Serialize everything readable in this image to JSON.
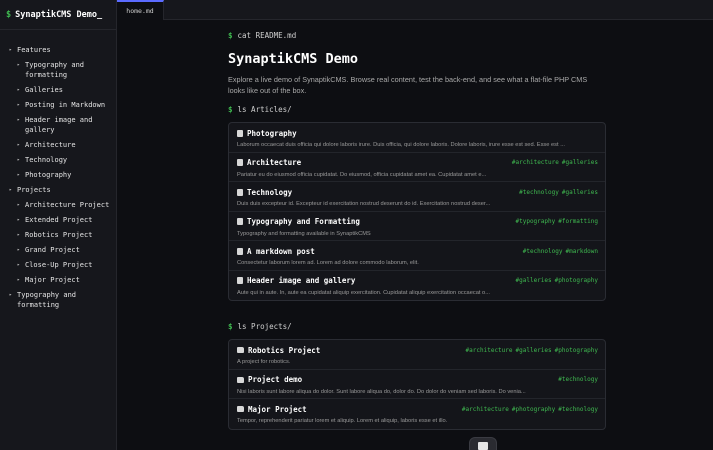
{
  "site": {
    "title": "SynaptikCMS Demo_"
  },
  "tab": {
    "label": "home.md"
  },
  "sidebar": {
    "items": [
      {
        "label": "Features",
        "level": 1
      },
      {
        "label": "Typography and formatting",
        "level": 2
      },
      {
        "label": "Galleries",
        "level": 2
      },
      {
        "label": "Posting in Markdown",
        "level": 2
      },
      {
        "label": "Header image and gallery",
        "level": 2
      },
      {
        "label": "Architecture",
        "level": 2
      },
      {
        "label": "Technology",
        "level": 2
      },
      {
        "label": "Photography",
        "level": 2
      },
      {
        "label": "Projects",
        "level": 1
      },
      {
        "label": "Architecture Project",
        "level": 2
      },
      {
        "label": "Extended Project",
        "level": 2
      },
      {
        "label": "Robotics Project",
        "level": 2
      },
      {
        "label": "Grand Project",
        "level": 2
      },
      {
        "label": "Close-Up Project",
        "level": 2
      },
      {
        "label": "Major Project",
        "level": 2
      },
      {
        "label": "Typography and formatting",
        "level": 1
      }
    ]
  },
  "main": {
    "cmd_readme": "cat README.md",
    "title": "SynaptikCMS Demo",
    "intro": "Explore a live demo of SynaptikCMS. Browse real content, test the back-end, and see what a flat-file PHP CMS looks like out of the box.",
    "cmd_articles": "ls Articles/",
    "cmd_projects": "ls Projects/",
    "articles": [
      {
        "title": "Photography",
        "desc": "Laborum occaecat duis officia qui dolore laboris irure. Duis officia, qui dolore laboris. Dolore laboris, irure esse est sed. Esse est ...",
        "tags": []
      },
      {
        "title": "Architecture",
        "desc": "Pariatur eu do eiusmod officia cupidatat. Do eiusmod, officia cupidatat amet ea. Cupidatat amet e...",
        "tags": [
          "#architecture",
          "#galleries"
        ]
      },
      {
        "title": "Technology",
        "desc": "Duis duis excepteur id. Excepteur id exercitation nostrud deserunt do id. Exercitation nostrud deser...",
        "tags": [
          "#technology",
          "#galleries"
        ]
      },
      {
        "title": "Typography and Formatting",
        "desc": "Typography and formatting available in SynaptikCMS",
        "tags": [
          "#typography",
          "#formatting"
        ]
      },
      {
        "title": "A markdown post",
        "desc": "Consectetur laborum lorem ad. Lorem ad dolore commodo laborum, elit.",
        "tags": [
          "#technology",
          "#markdown"
        ]
      },
      {
        "title": "Header image and gallery",
        "desc": "Aute qui in aute. In, aute ea cupidatat aliquip exercitation. Cupidatat aliquip exercitation occaecat o...",
        "tags": [
          "#galleries",
          "#photography"
        ]
      }
    ],
    "projects": [
      {
        "title": "Robotics Project",
        "desc": "A project for robotics.",
        "tags": [
          "#architecture",
          "#galleries",
          "#photography"
        ]
      },
      {
        "title": "Project demo",
        "desc": "Nisi laboris sunt labore aliqua do dolor. Sunt labore aliqua do, dolor do. Do dolor do veniam sed laboris. Do venia...",
        "tags": [
          "#technology"
        ]
      },
      {
        "title": "Major Project",
        "desc": "Tempor, reprehenderit pariatur lorem et aliquip. Lorem et aliquip, laboris esse et illo.",
        "tags": [
          "#architecture",
          "#photography",
          "#technology"
        ]
      }
    ]
  },
  "colors": {
    "accent": "#3fb950",
    "tab_accent": "#5b6bff",
    "background": "#0d0e12",
    "sidebar": "#16171c"
  },
  "icons": {
    "article": "file-icon",
    "project": "folder-icon",
    "nav": "triangle-right-icon"
  }
}
